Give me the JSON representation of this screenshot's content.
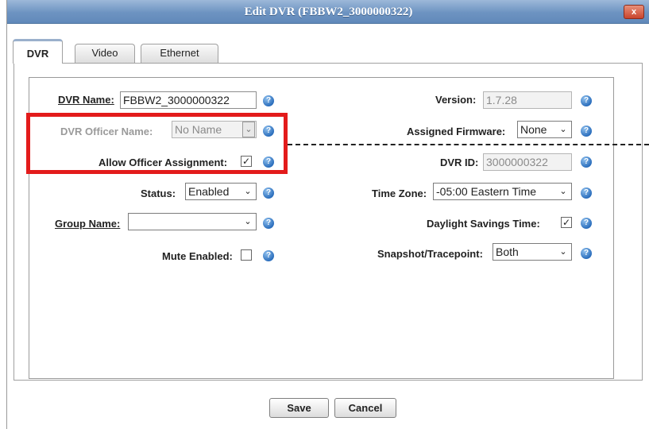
{
  "dialog": {
    "title": "Edit DVR (FBBW2_3000000322)",
    "close_label": "x"
  },
  "tabs": [
    {
      "label": "DVR",
      "active": true
    },
    {
      "label": "Video",
      "active": false
    },
    {
      "label": "Ethernet",
      "active": false
    }
  ],
  "left": {
    "dvr_name": {
      "label": "DVR Name:",
      "value": "FBBW2_3000000322"
    },
    "officer_name": {
      "label": "DVR Officer Name:",
      "value": "No Name",
      "disabled": true
    },
    "allow_assignment": {
      "label": "Allow Officer Assignment:",
      "checked": true
    },
    "status": {
      "label": "Status:",
      "value": "Enabled"
    },
    "group_name": {
      "label": "Group Name:",
      "value": ""
    },
    "mute_enabled": {
      "label": "Mute Enabled:",
      "checked": false
    }
  },
  "right": {
    "version": {
      "label": "Version:",
      "value": "1.7.28"
    },
    "assigned_firmware": {
      "label": "Assigned Firmware:",
      "value": "None"
    },
    "dvr_id": {
      "label": "DVR ID:",
      "value": "3000000322"
    },
    "time_zone": {
      "label": "Time Zone:",
      "value": "-05:00 Eastern Time"
    },
    "daylight_savings": {
      "label": "Daylight Savings Time:",
      "checked": true
    },
    "snapshot": {
      "label": "Snapshot/Tracepoint:",
      "value": "Both"
    }
  },
  "buttons": {
    "save": "Save",
    "cancel": "Cancel"
  },
  "glyphs": {
    "check": "✓",
    "caret": "⌄",
    "help": "?"
  },
  "colors": {
    "titlebar": "#6d93c1",
    "highlight": "#e31b1b",
    "help_icon": "#2c6fbd"
  }
}
